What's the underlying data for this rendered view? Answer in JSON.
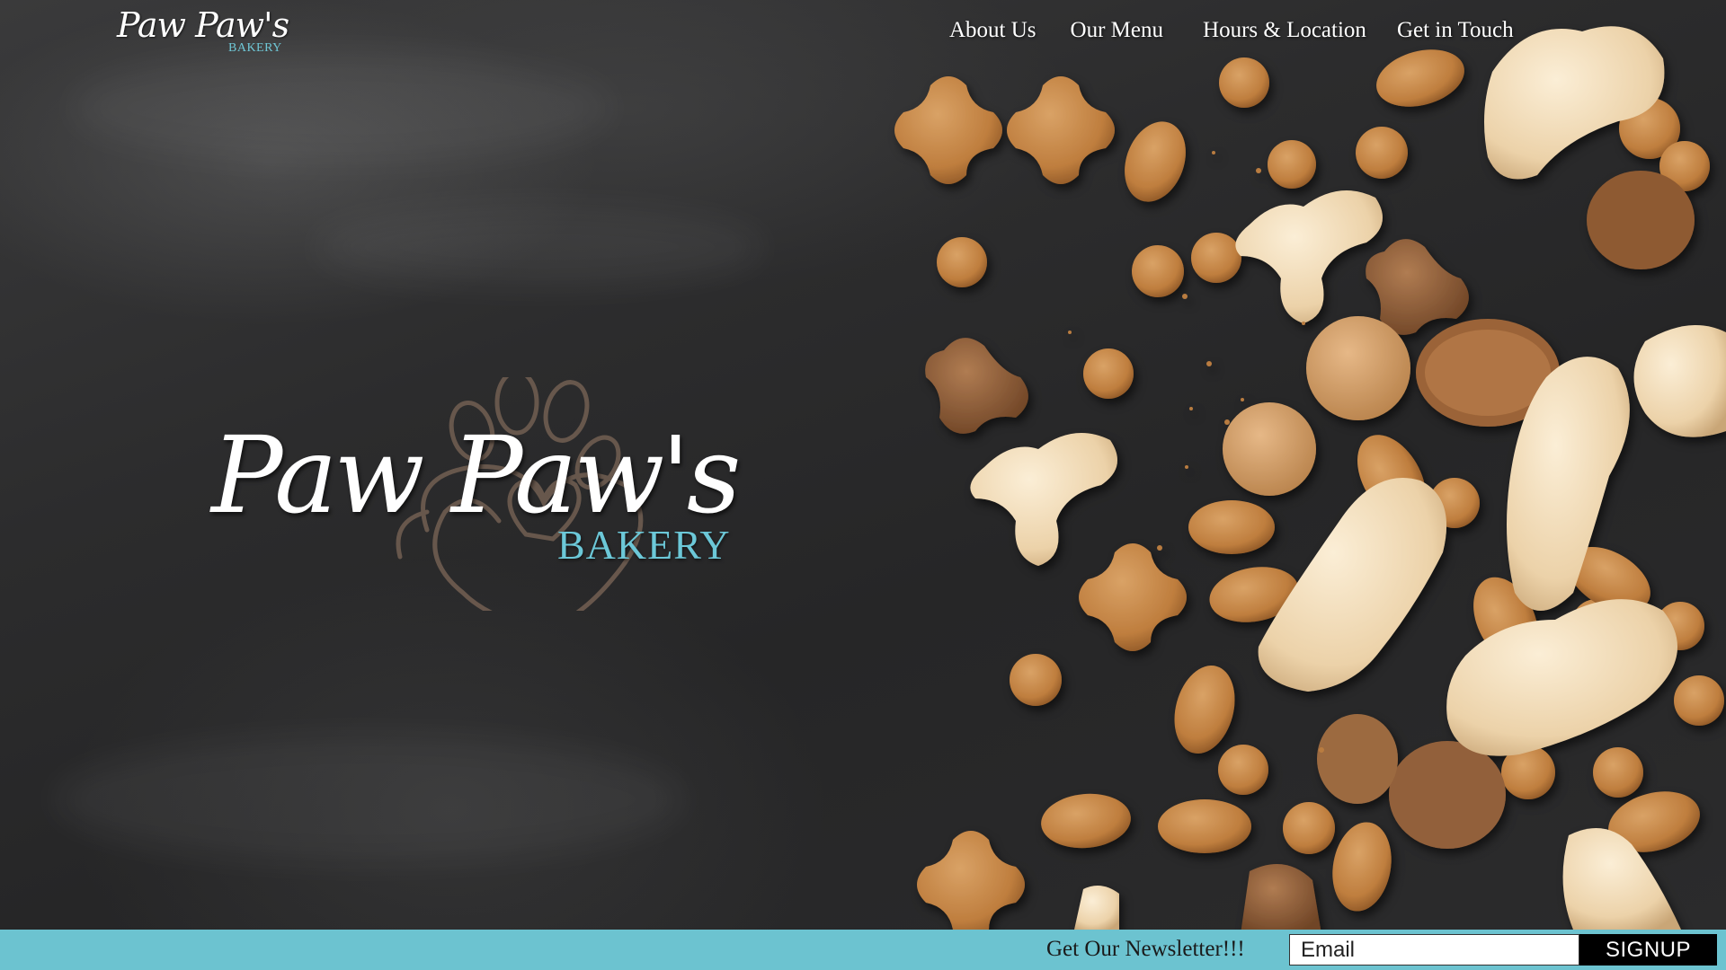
{
  "brand": {
    "name_script": "Paw Paw's",
    "name_sub": "BAKERY",
    "accent_color": "#6cc3d0"
  },
  "nav": {
    "items": [
      {
        "label": "About Us"
      },
      {
        "label": "Our Menu"
      },
      {
        "label": "Hours & Location"
      },
      {
        "label": "Get in Touch"
      }
    ]
  },
  "hero": {
    "background": "chalkboard",
    "image": "scattered dog treats and biscuits",
    "logo_icon": "paw-print-heart-icon"
  },
  "newsletter": {
    "label": "Get Our Newsletter!!!",
    "email_placeholder": "Email",
    "email_value": "",
    "button_label": "SIGNUP"
  }
}
